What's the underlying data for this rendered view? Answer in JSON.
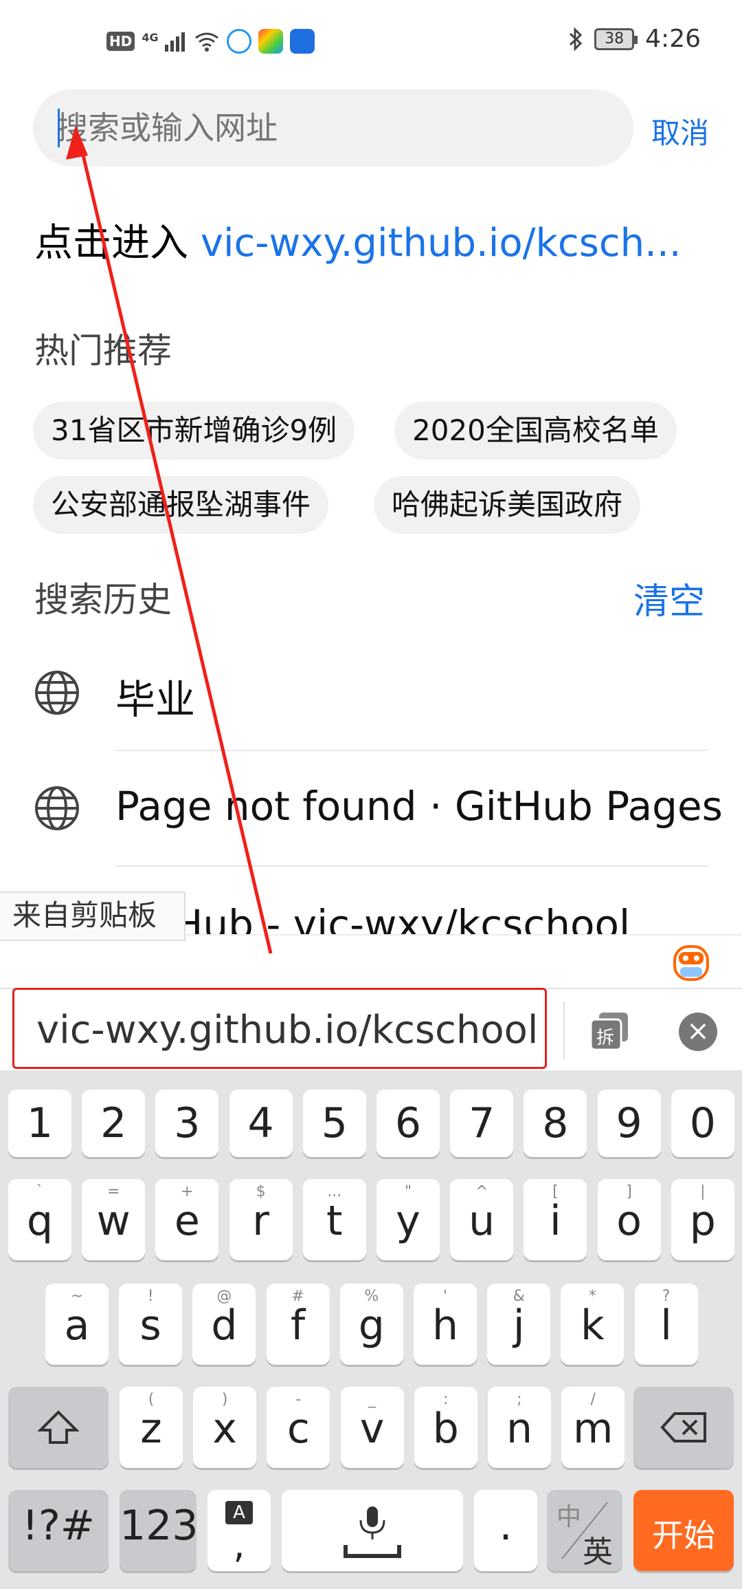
{
  "status_bar": {
    "network": "HD",
    "signal": "4G",
    "battery": "38",
    "time": "4:26",
    "icons": [
      "hd-icon",
      "signal-icon",
      "wifi-icon",
      "app-icon-cloud",
      "app-icon-green",
      "app-icon-run",
      "bluetooth-icon",
      "battery-icon"
    ]
  },
  "search": {
    "placeholder": "搜索或输入网址",
    "cancel_label": "取消"
  },
  "visit": {
    "prefix": "点击进入 ",
    "url": "vic-wxy.github.io/kcsch..."
  },
  "hot": {
    "title": "热门推荐",
    "items": [
      "31省区市新增确诊9例",
      "2020全国高校名单",
      "公安部通报坠湖事件",
      "哈佛起诉美国政府"
    ]
  },
  "history": {
    "title": "搜索历史",
    "clear_label": "清空",
    "items": [
      "毕业",
      "Page not found · GitHub Pages",
      "GitHub - vic-wxy/kcschool"
    ]
  },
  "clipboard": {
    "tab_label": "来自剪贴板",
    "text": "vic-wxy.github.io/kcschool",
    "split_label": "拆"
  },
  "keyboard": {
    "row1": [
      {
        "m": "1"
      },
      {
        "m": "2"
      },
      {
        "m": "3"
      },
      {
        "m": "4"
      },
      {
        "m": "5"
      },
      {
        "m": "6"
      },
      {
        "m": "7"
      },
      {
        "m": "8"
      },
      {
        "m": "9"
      },
      {
        "m": "0"
      }
    ],
    "row2": [
      {
        "m": "q",
        "s": "`"
      },
      {
        "m": "w",
        "s": "="
      },
      {
        "m": "e",
        "s": "+"
      },
      {
        "m": "r",
        "s": "$"
      },
      {
        "m": "t",
        "s": "..."
      },
      {
        "m": "y",
        "s": "\""
      },
      {
        "m": "u",
        "s": "^"
      },
      {
        "m": "i",
        "s": "["
      },
      {
        "m": "o",
        "s": "]"
      },
      {
        "m": "p",
        "s": "|"
      }
    ],
    "row3": [
      {
        "m": "a",
        "s": "~"
      },
      {
        "m": "s",
        "s": "!"
      },
      {
        "m": "d",
        "s": "@"
      },
      {
        "m": "f",
        "s": "#"
      },
      {
        "m": "g",
        "s": "%"
      },
      {
        "m": "h",
        "s": "'"
      },
      {
        "m": "j",
        "s": "&"
      },
      {
        "m": "k",
        "s": "*"
      },
      {
        "m": "l",
        "s": "?"
      }
    ],
    "row4": [
      {
        "m": "z",
        "s": "("
      },
      {
        "m": "x",
        "s": ")"
      },
      {
        "m": "c",
        "s": "-"
      },
      {
        "m": "v",
        "s": "_"
      },
      {
        "m": "b",
        "s": ":"
      },
      {
        "m": "n",
        "s": ";"
      },
      {
        "m": "m",
        "s": "/"
      }
    ],
    "symbols_label": "!?#",
    "numbers_label": "123",
    "comma_top": "A",
    "comma_label": ",",
    "period_label": ".",
    "lang_top": "中",
    "lang_bottom": "英",
    "go_label": "开始"
  }
}
